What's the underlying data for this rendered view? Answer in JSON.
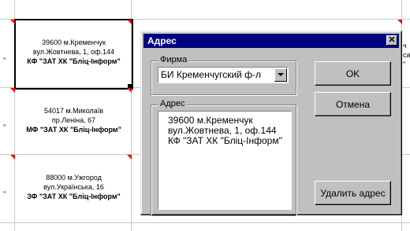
{
  "sheet": {
    "cells": [
      {
        "line1": "39600 м.Кременчук",
        "line2": "вул.Жовтнева, 1, оф.144",
        "line3": "КФ  \"ЗАТ ХК \"Бліц-Інформ\""
      },
      {
        "line1": "54017 м.Миколаїв",
        "line2": "пр.Леніна, 67",
        "line3": "МФ  \"ЗАТ ХК \"Бліц-Інформ\""
      },
      {
        "line1": "88000 м.Ужгород",
        "line2": "вул.Українська, 16",
        "line3": "ЗФ  \"ЗАТ ХК \"Бліц-Інформ\""
      }
    ],
    "edge_text": {
      "line1": "ч",
      "line2": "са",
      "line3": "\""
    }
  },
  "dialog": {
    "title": "Адрес",
    "close_symbol": "✕",
    "firm_group_label": "Фирма",
    "firm_selected": "БИ Кременчугский ф-л",
    "address_group_label": "Адрес",
    "address_lines": [
      "39600 м.Кременчук",
      "вул.Жовтнева, 1, оф.144",
      "КФ  \"ЗАТ ХК \"Бліц-Інформ\""
    ],
    "ok_label": "OK",
    "cancel_label": "Отмена",
    "delete_label": "Удалить адрес"
  },
  "icons": {
    "close": "close-icon",
    "dropdown": "chevron-down-icon"
  }
}
